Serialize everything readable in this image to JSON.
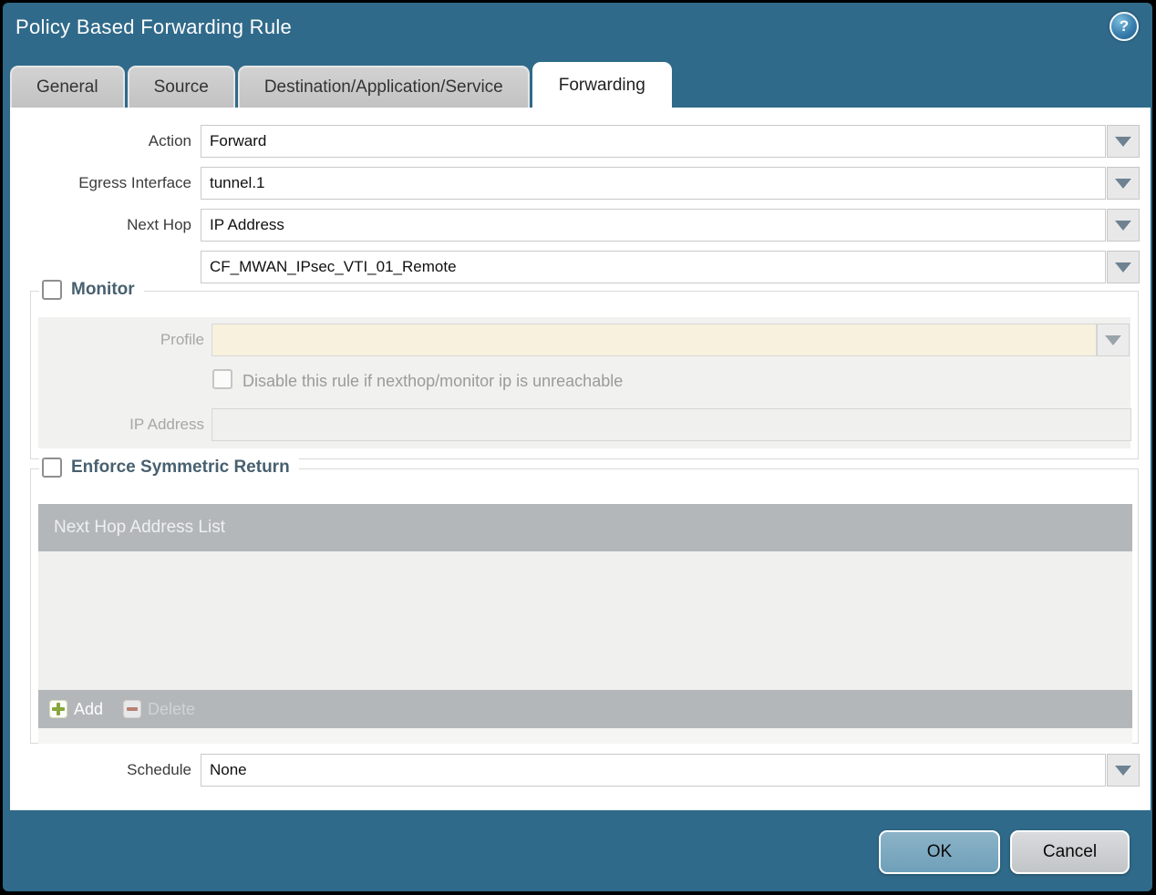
{
  "dialog": {
    "title": "Policy Based Forwarding Rule",
    "help_glyph": "?"
  },
  "tabs": [
    {
      "label": "General",
      "active": false
    },
    {
      "label": "Source",
      "active": false
    },
    {
      "label": "Destination/Application/Service",
      "active": false
    },
    {
      "label": "Forwarding",
      "active": true
    }
  ],
  "form": {
    "action": {
      "label": "Action",
      "value": "Forward"
    },
    "egress_interface": {
      "label": "Egress Interface",
      "value": "tunnel.1"
    },
    "next_hop": {
      "label": "Next Hop",
      "value": "IP Address"
    },
    "next_hop_address": {
      "value": "CF_MWAN_IPsec_VTI_01_Remote"
    },
    "schedule": {
      "label": "Schedule",
      "value": "None"
    }
  },
  "monitor": {
    "legend": "Monitor",
    "checked": false,
    "profile": {
      "label": "Profile",
      "value": "",
      "disabled": true
    },
    "disable_rule": {
      "label": "Disable this rule if nexthop/monitor ip is unreachable",
      "checked": false,
      "disabled": true
    },
    "ip_address": {
      "label": "IP Address",
      "value": "",
      "disabled": true
    }
  },
  "symmetric_return": {
    "legend": "Enforce Symmetric Return",
    "checked": false,
    "table_header": "Next Hop Address List",
    "rows": [],
    "add_label": "Add",
    "delete_label": "Delete",
    "delete_disabled": true
  },
  "footer": {
    "ok_label": "OK",
    "cancel_label": "Cancel"
  },
  "colors": {
    "frame_blue": "#306a8a",
    "tab_inactive": "#c9c9c9",
    "table_gray": "#b3b7ba",
    "panel_gray": "#f1f1f0",
    "profile_disabled_bg": "#f7f1de",
    "legend_text": "#48606f",
    "add_green": "#86a73c",
    "delete_red": "#b97e72",
    "ok_button": "#7aa9c1",
    "cancel_button": "#ccd0d2"
  }
}
